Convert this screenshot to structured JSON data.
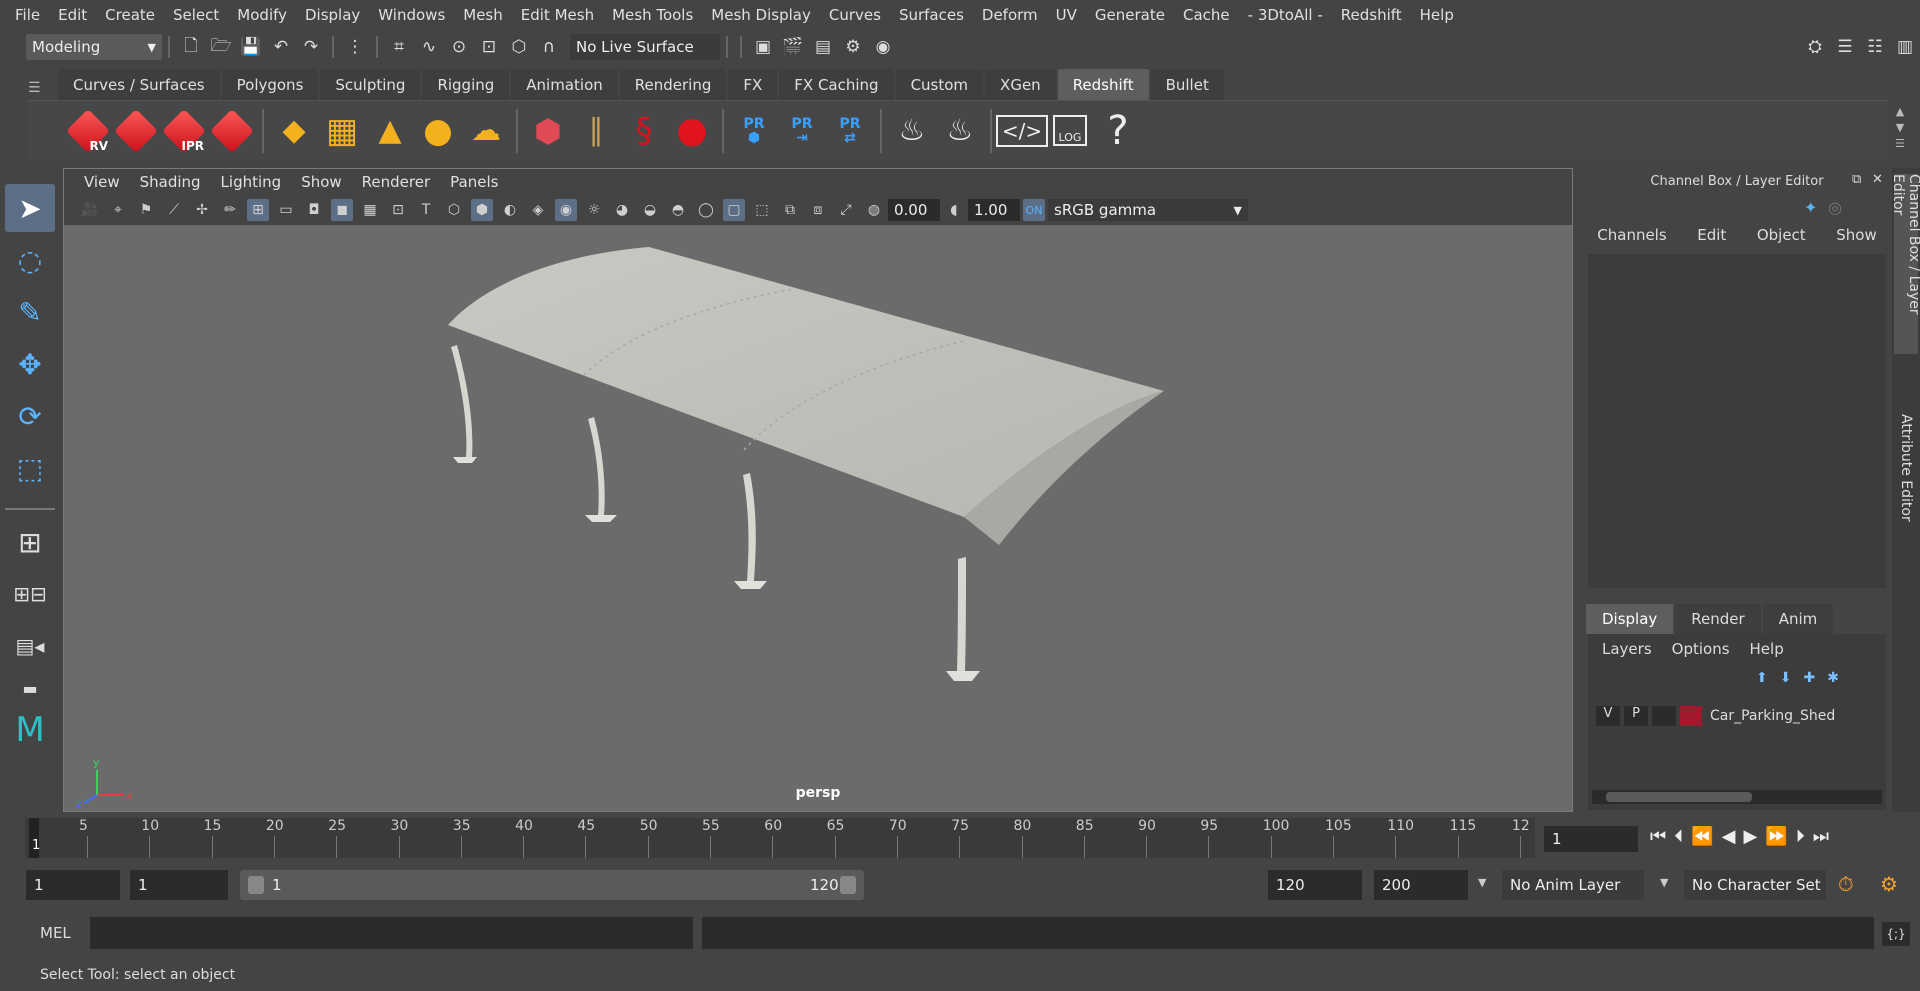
{
  "menubar": {
    "items": [
      "File",
      "Edit",
      "Create",
      "Select",
      "Modify",
      "Display",
      "Windows",
      "Mesh",
      "Edit Mesh",
      "Mesh Tools",
      "Mesh Display",
      "Curves",
      "Surfaces",
      "Deform",
      "UV",
      "Generate",
      "Cache",
      "- 3DtoAll -",
      "Redshift",
      "Help"
    ]
  },
  "statusline": {
    "mode": "Modeling",
    "live_surface": "No Live Surface"
  },
  "shelf": {
    "tabs": [
      "Curves / Surfaces",
      "Polygons",
      "Sculpting",
      "Rigging",
      "Animation",
      "Rendering",
      "FX",
      "FX Caching",
      "Custom",
      "XGen",
      "Redshift",
      "Bullet"
    ],
    "active_tab": "Redshift",
    "rs_icons": [
      {
        "label": "RV"
      },
      {
        "label": ""
      },
      {
        "label": "IPR"
      },
      {
        "label": ""
      }
    ],
    "pr_labels": [
      "PR",
      "PR",
      "PR"
    ],
    "log_label": "LOG",
    "help_glyph": "?"
  },
  "viewport": {
    "menu": [
      "View",
      "Shading",
      "Lighting",
      "Show",
      "Renderer",
      "Panels"
    ],
    "exposure": "0.00",
    "gamma": "1.00",
    "color_space": "sRGB gamma",
    "camera_label": "persp",
    "axis_x": "x",
    "axis_y": "y",
    "axis_z": "z"
  },
  "channelbox": {
    "title": "Channel Box / Layer Editor",
    "menu": [
      "Channels",
      "Edit",
      "Object",
      "Show"
    ],
    "layer_tabs": [
      "Display",
      "Render",
      "Anim"
    ],
    "active_layer_tab": "Display",
    "layer_menu": [
      "Layers",
      "Options",
      "Help"
    ],
    "layers": [
      {
        "v": "V",
        "p": "P",
        "name": "Car_Parking_Shed",
        "color": "#a01a2e"
      }
    ]
  },
  "side_tabs": [
    "Channel Box / Layer Editor",
    "Attribute Editor"
  ],
  "timeslider": {
    "ticks": [
      "5",
      "10",
      "15",
      "20",
      "25",
      "30",
      "35",
      "40",
      "45",
      "50",
      "55",
      "60",
      "65",
      "70",
      "75",
      "80",
      "85",
      "90",
      "95",
      "100",
      "105",
      "110",
      "115",
      "12"
    ],
    "current_marker": "1",
    "current_frame": "1"
  },
  "rangebar": {
    "start": "1",
    "playback_start": "1",
    "range_min": "1",
    "range_max": "120",
    "playback_end": "120",
    "end": "200",
    "anim_layer": "No Anim Layer",
    "char_set": "No Character Set"
  },
  "cmdline": {
    "lang": "MEL"
  },
  "helpline": {
    "text": "Select Tool: select an object"
  },
  "colors": {
    "accent": "#5c6f87",
    "redshift": "#c8101a",
    "pr_blue": "#3aa0ff",
    "shelf_yellow": "#f3b21d"
  }
}
